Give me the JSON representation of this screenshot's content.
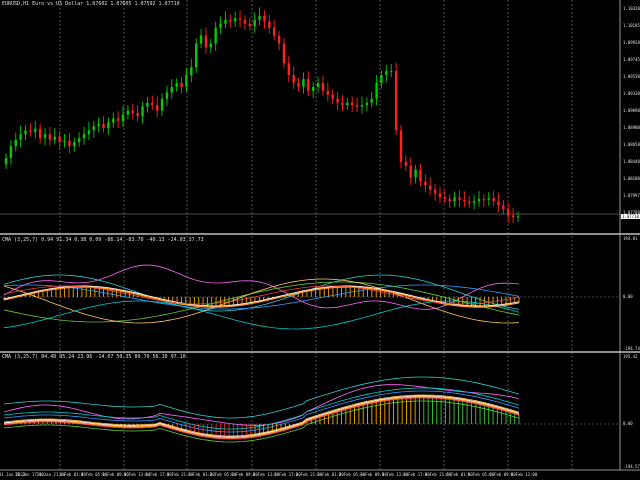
{
  "main_header": "EURUSD,H1  Euro vs US Dollar  1.07602  1.07605  1.07592  1.07710",
  "ind1_header": "CMA (3,25,7) 0.94  91.34 0.38 0.09 -86.14 -83.70  -40.13  -24.03 37.73",
  "ind2_header": "CMA (3,25,7) 84.48 95.24 23.96 -14.07 50.35 89.70 56.10 97.10",
  "price_axis": [
    "1.10320",
    "1.10185",
    "1.09928",
    "1.09745",
    "1.09538",
    "1.09320",
    "1.09090",
    "1.08900",
    "1.08650",
    "1.08440",
    "1.08100",
    "1.07997",
    "1.07788"
  ],
  "price_tag": "1.07710",
  "ind1_axis": {
    "top": "194.81",
    "zero": "0.00",
    "bottom": "-194.74"
  },
  "ind2_axis": {
    "top": "195.42",
    "zero": "0.00",
    "bottom": "-194.57"
  },
  "time_axis": [
    "31 Jan 2023",
    "31 Jan 17:00",
    "31 Jan 21:00",
    "1 Feb 01:00",
    "1 Feb 05:00",
    "1 Feb 09:00",
    "1 Feb 13:00",
    "1 Feb 17:00",
    "1 Feb 21:00",
    "2 Feb 01:00",
    "2 Feb 05:00",
    "2 Feb 09:00",
    "2 Feb 13:00",
    "2 Feb 17:00",
    "2 Feb 21:00",
    "3 Feb 01:00",
    "3 Feb 05:00",
    "3 Feb 09:00",
    "3 Feb 13:00",
    "3 Feb 17:00",
    "3 Feb 21:00",
    "6 Feb 01:00",
    "6 Feb 05:00",
    "6 Feb 09:00",
    "6 Feb 13:00"
  ],
  "colors": {
    "bull": "#00cc00",
    "bear": "#ff2020",
    "grid": "#8a8a8a",
    "divider": "#bfbfbf",
    "hist_orange": "#ffa500",
    "hist_green": "#33cc33",
    "hist_red": "#ff2020"
  },
  "chart_data": {
    "type": "candlestick",
    "closes": [
      1.0845,
      1.086,
      1.0868,
      1.0875,
      1.088,
      1.0878,
      1.0882,
      1.087,
      1.0875,
      1.0868,
      1.0872,
      1.0865,
      1.0867,
      1.086,
      1.0865,
      1.087,
      1.0875,
      1.088,
      1.0885,
      1.0888,
      1.0883,
      1.089,
      1.0895,
      1.0892,
      1.09,
      1.0905,
      1.0902,
      1.0898,
      1.091,
      1.0915,
      1.0912,
      1.0905,
      1.092,
      1.0928,
      1.0935,
      1.094,
      1.0935,
      1.095,
      1.096,
      1.099,
      1.1,
      1.0985,
      1.099,
      1.101,
      1.1015,
      1.102,
      1.1018,
      1.1022,
      1.102,
      1.1015,
      1.1012,
      1.102,
      1.1025,
      1.1018,
      1.101,
      1.1,
      1.099,
      1.0965,
      1.095,
      1.094,
      1.0935,
      1.0945,
      1.093,
      1.0935,
      1.094,
      1.093,
      1.0925,
      1.092,
      1.0915,
      1.0912,
      1.0915,
      1.0912,
      1.091,
      1.0912,
      1.0915,
      1.092,
      1.094,
      1.095,
      1.0955,
      1.0955,
      1.088,
      1.084,
      1.0835,
      1.082,
      1.083,
      1.0815,
      1.081,
      1.0805,
      1.08,
      1.0795,
      1.0793,
      1.079,
      1.0795,
      1.0792,
      1.079,
      1.0788,
      1.079,
      1.0793,
      1.0792,
      1.0794,
      1.079,
      1.0785,
      1.078,
      1.0772,
      1.077,
      1.0771
    ]
  }
}
